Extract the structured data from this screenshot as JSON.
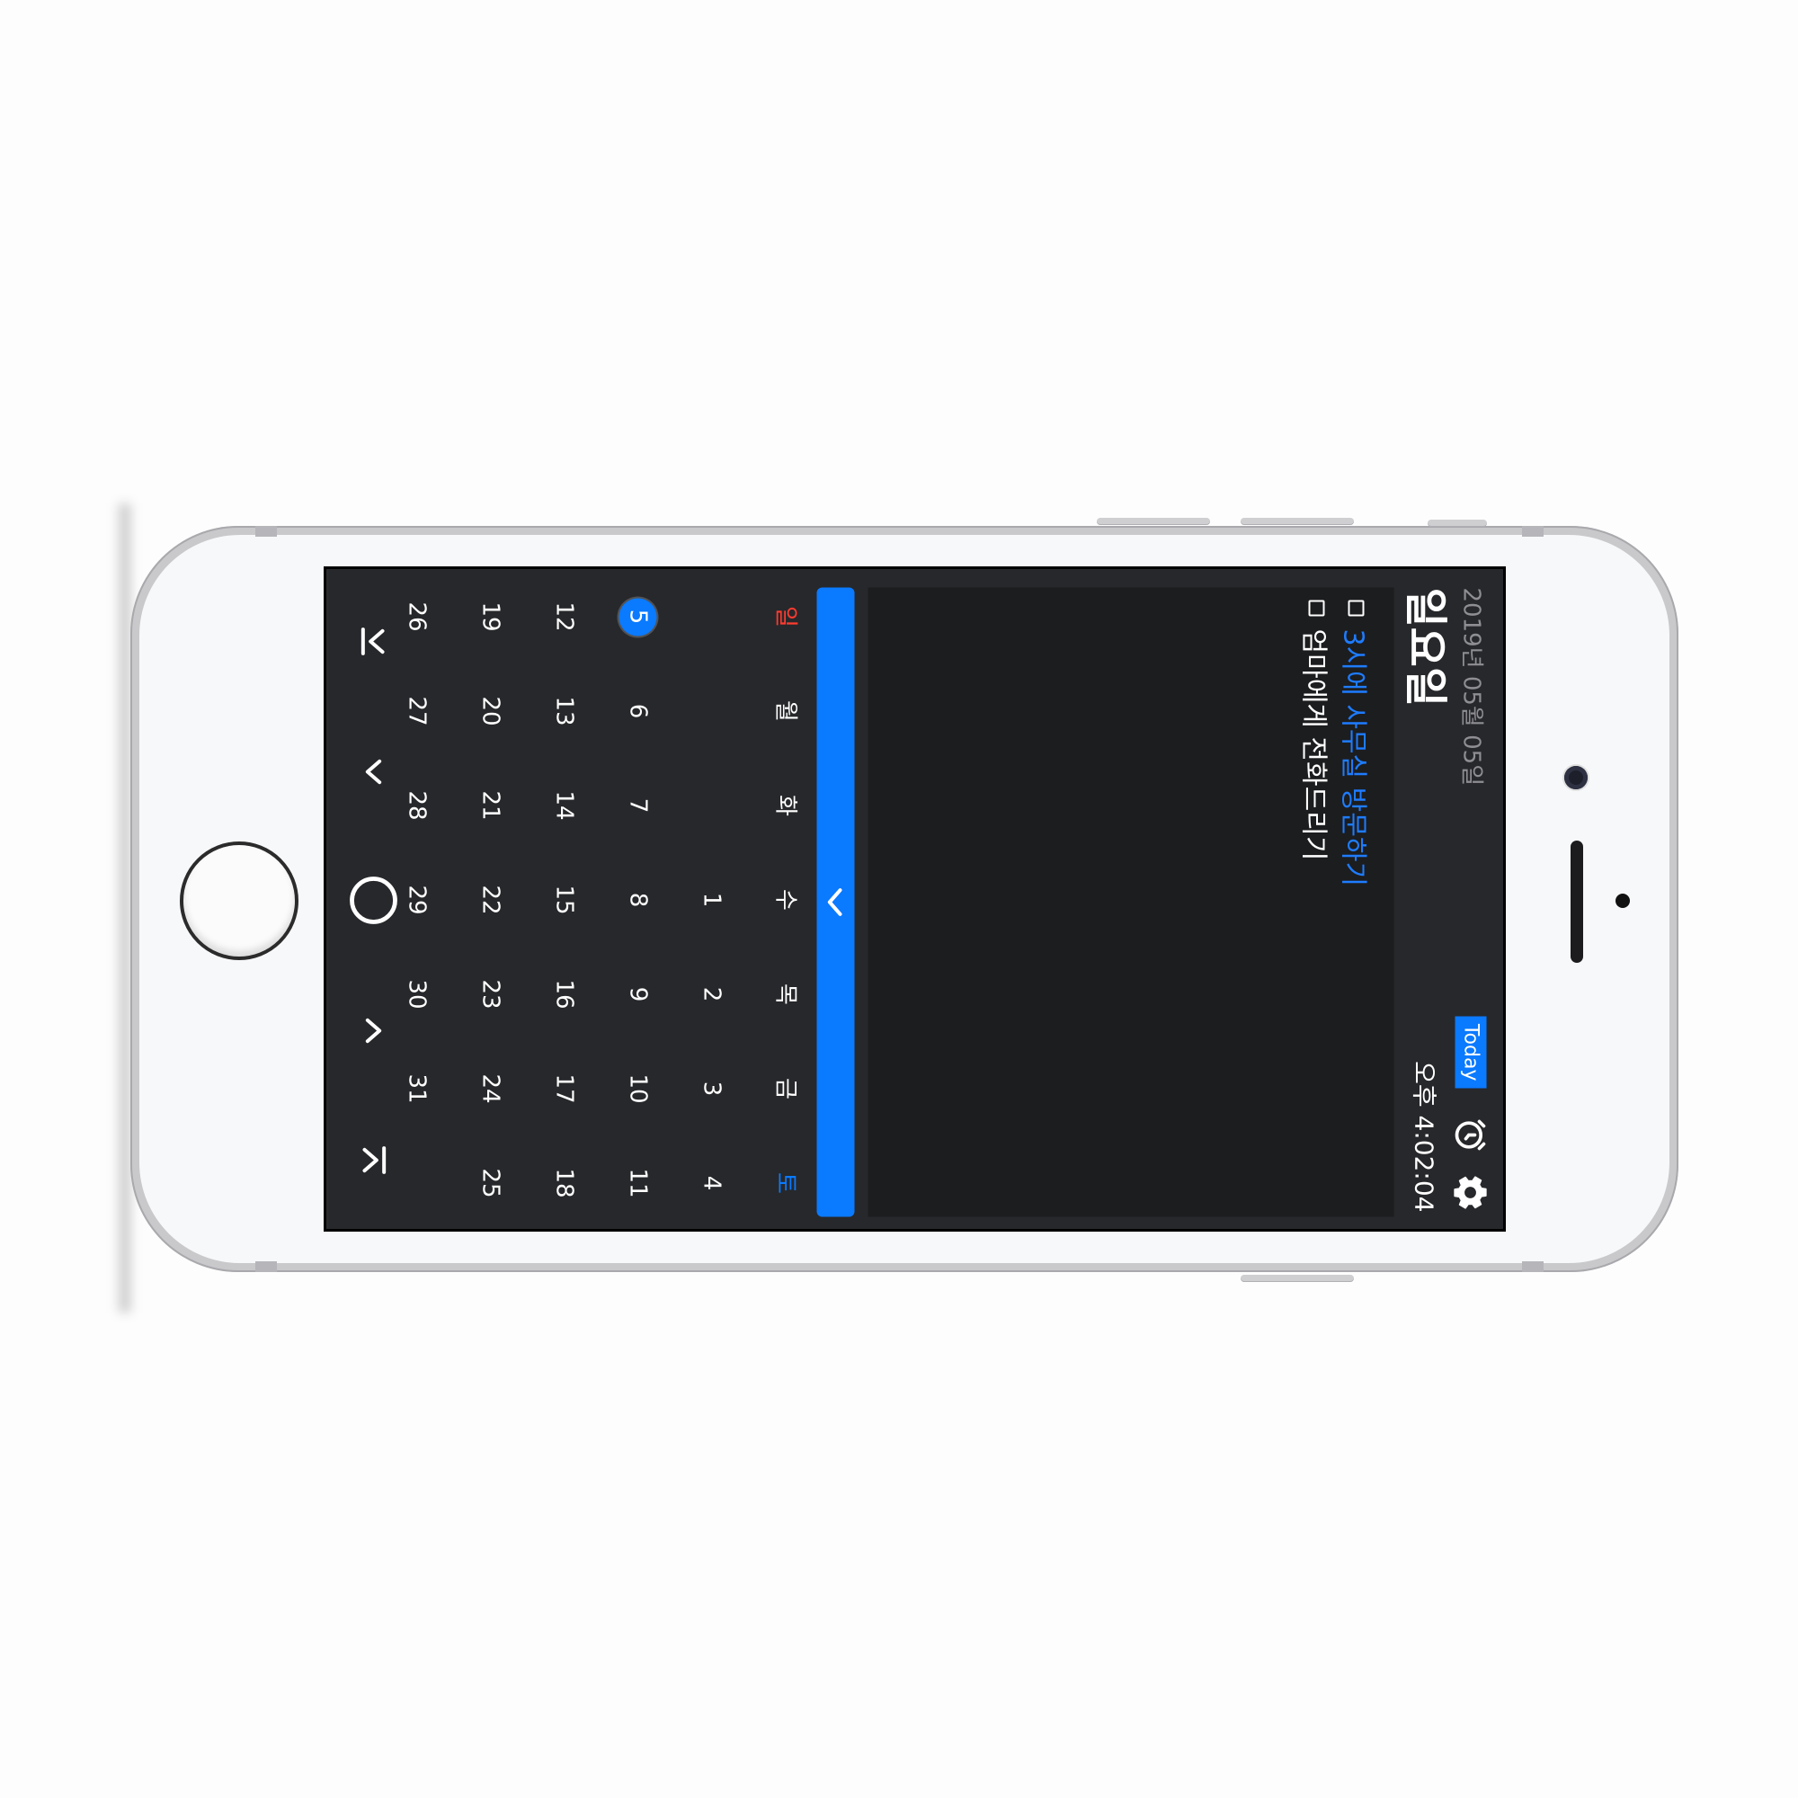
{
  "header": {
    "date": "2019년 05월 05일",
    "weekday": "일요일",
    "today_label": "Today",
    "clock": "오후 4:02:04"
  },
  "icons": {
    "settings": "gear-icon",
    "alarm": "alarm-clock-icon",
    "collapse": "chevron-left-icon",
    "nav_first": "first-page-icon",
    "nav_prev": "chevron-up-icon",
    "nav_today": "circle-icon",
    "nav_next": "chevron-down-icon",
    "nav_last": "last-page-icon"
  },
  "todos": [
    {
      "text": "3시에 사무실 방문하기",
      "highlight": true
    },
    {
      "text": "엄마에게 전화드리기",
      "highlight": false
    }
  ],
  "calendar": {
    "weekdays": [
      "일",
      "월",
      "화",
      "수",
      "목",
      "금",
      "토"
    ],
    "weeks": [
      [
        "",
        "",
        "",
        "1",
        "2",
        "3",
        "4"
      ],
      [
        "5",
        "6",
        "7",
        "8",
        "9",
        "10",
        "11"
      ],
      [
        "12",
        "13",
        "14",
        "15",
        "16",
        "17",
        "18"
      ],
      [
        "19",
        "20",
        "21",
        "22",
        "23",
        "24",
        "25"
      ],
      [
        "26",
        "27",
        "28",
        "29",
        "30",
        "31",
        ""
      ]
    ],
    "selected_day": "5"
  },
  "colors": {
    "accent": "#0a7aff",
    "sunday": "#ff3b30",
    "saturday": "#0a7aff",
    "background": "#27282b",
    "panel": "#1c1d1f"
  }
}
